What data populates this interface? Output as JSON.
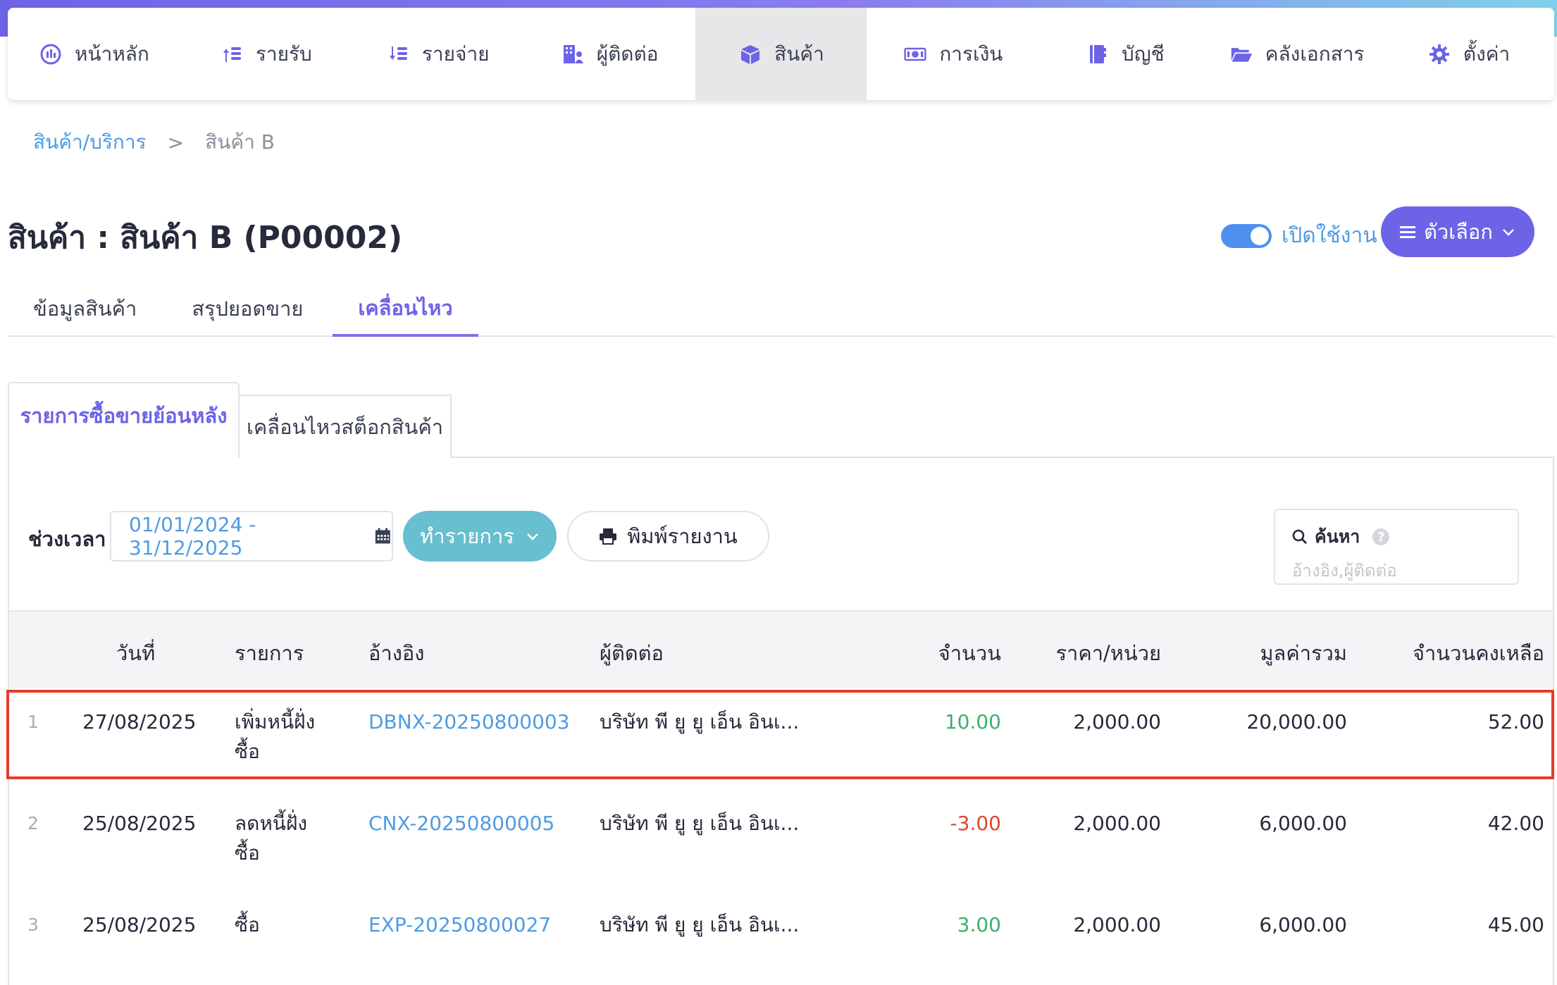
{
  "nav": {
    "items": [
      {
        "label": "หน้าหลัก",
        "icon": "dashboard-gauge-icon"
      },
      {
        "label": "รายรับ",
        "icon": "income-coins-icon"
      },
      {
        "label": "รายจ่าย",
        "icon": "expense-coins-icon"
      },
      {
        "label": "ผู้ติดต่อ",
        "icon": "contacts-building-icon"
      },
      {
        "label": "สินค้า",
        "icon": "product-box-icon"
      },
      {
        "label": "การเงิน",
        "icon": "finance-money-icon"
      },
      {
        "label": "บัญชี",
        "icon": "accounting-book-icon"
      },
      {
        "label": "คลังเอกสาร",
        "icon": "documents-folder-icon"
      },
      {
        "label": "ตั้งค่า",
        "icon": "settings-gear-icon"
      }
    ],
    "active_index": 4
  },
  "breadcrumb": {
    "parent": "สินค้า/บริการ",
    "separator": ">",
    "current": "สินค้า B"
  },
  "page": {
    "title": "สินค้า : สินค้า B (P00002)",
    "toggle_label": "เปิดใช้งาน",
    "toggle_on": true,
    "options_label": "ตัวเลือก"
  },
  "tabs": {
    "items": [
      "ข้อมูลสินค้า",
      "สรุปยอดขาย",
      "เคลื่อนไหว"
    ],
    "active_index": 2
  },
  "subtabs": {
    "active": "รายการซื้อขายย้อนหลัง",
    "other": "เคลื่อนไหวสต็อกสินค้า"
  },
  "filter": {
    "label": "ช่วงเวลา",
    "date_range": "01/01/2024 - 31/12/2025",
    "action_label": "ทำรายการ",
    "print_label": "พิมพ์รายงาน"
  },
  "search": {
    "label": "ค้นหา",
    "help": "?",
    "placeholder": "อ้างอิง,ผู้ติดต่อ"
  },
  "table": {
    "headers": {
      "date": "วันที่",
      "item": "รายการ",
      "ref": "อ้างอิง",
      "contact": "ผู้ติดต่อ",
      "qty": "จำนวน",
      "unit_price": "ราคา/หน่วย",
      "total": "มูลค่ารวม",
      "remaining": "จำนวนคงเหลือ"
    },
    "rows": [
      {
        "index": "1",
        "date": "27/08/2025",
        "item_line1": "เพิ่มหนี้ฝั่ง",
        "item_line2": "ซื้อ",
        "ref": "DBNX-20250800003",
        "contact": "บริษัท พี ยู ยู เอ็น อินเ...",
        "qty": "10.00",
        "qty_sign": "positive",
        "unit_price": "2,000.00",
        "total": "20,000.00",
        "remaining": "52.00",
        "highlighted": true
      },
      {
        "index": "2",
        "date": "25/08/2025",
        "item_line1": "ลดหนี้ฝั่ง",
        "item_line2": "ซื้อ",
        "ref": "CNX-20250800005",
        "contact": "บริษัท พี ยู ยู เอ็น อินเ...",
        "qty": "-3.00",
        "qty_sign": "negative",
        "unit_price": "2,000.00",
        "total": "6,000.00",
        "remaining": "42.00",
        "highlighted": false
      },
      {
        "index": "3",
        "date": "25/08/2025",
        "item_line1": "ซื้อ",
        "item_line2": "",
        "ref": "EXP-20250800027",
        "contact": "บริษัท พี ยู ยู เอ็น อินเ...",
        "qty": "3.00",
        "qty_sign": "positive",
        "unit_price": "2,000.00",
        "total": "6,000.00",
        "remaining": "45.00",
        "highlighted": false
      }
    ]
  },
  "colors": {
    "brand": "#6d63e6",
    "link": "#4f9be3",
    "teal_button": "#67bfcf",
    "positive": "#3cb06b",
    "negative": "#e2452f",
    "highlight_border": "#e23e2a"
  }
}
